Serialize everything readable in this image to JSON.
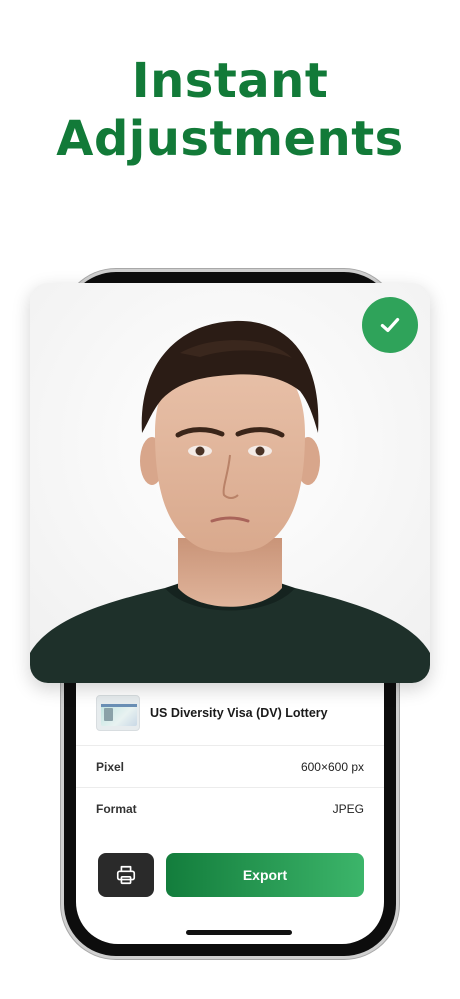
{
  "headline": {
    "line1": "Instant",
    "line2": "Adjustments"
  },
  "document": {
    "title": "US Diversity Visa (DV) Lottery"
  },
  "details": [
    {
      "label": "Pixel",
      "value": "600×600 px"
    },
    {
      "label": "Format",
      "value": "JPEG"
    }
  ],
  "actions": {
    "export_label": "Export"
  },
  "colors": {
    "brand_green": "#127a38",
    "check_green": "#2fa35a",
    "print_button": "#2a2a2a"
  },
  "icons": {
    "verified": "check-icon",
    "print": "printer-icon"
  }
}
